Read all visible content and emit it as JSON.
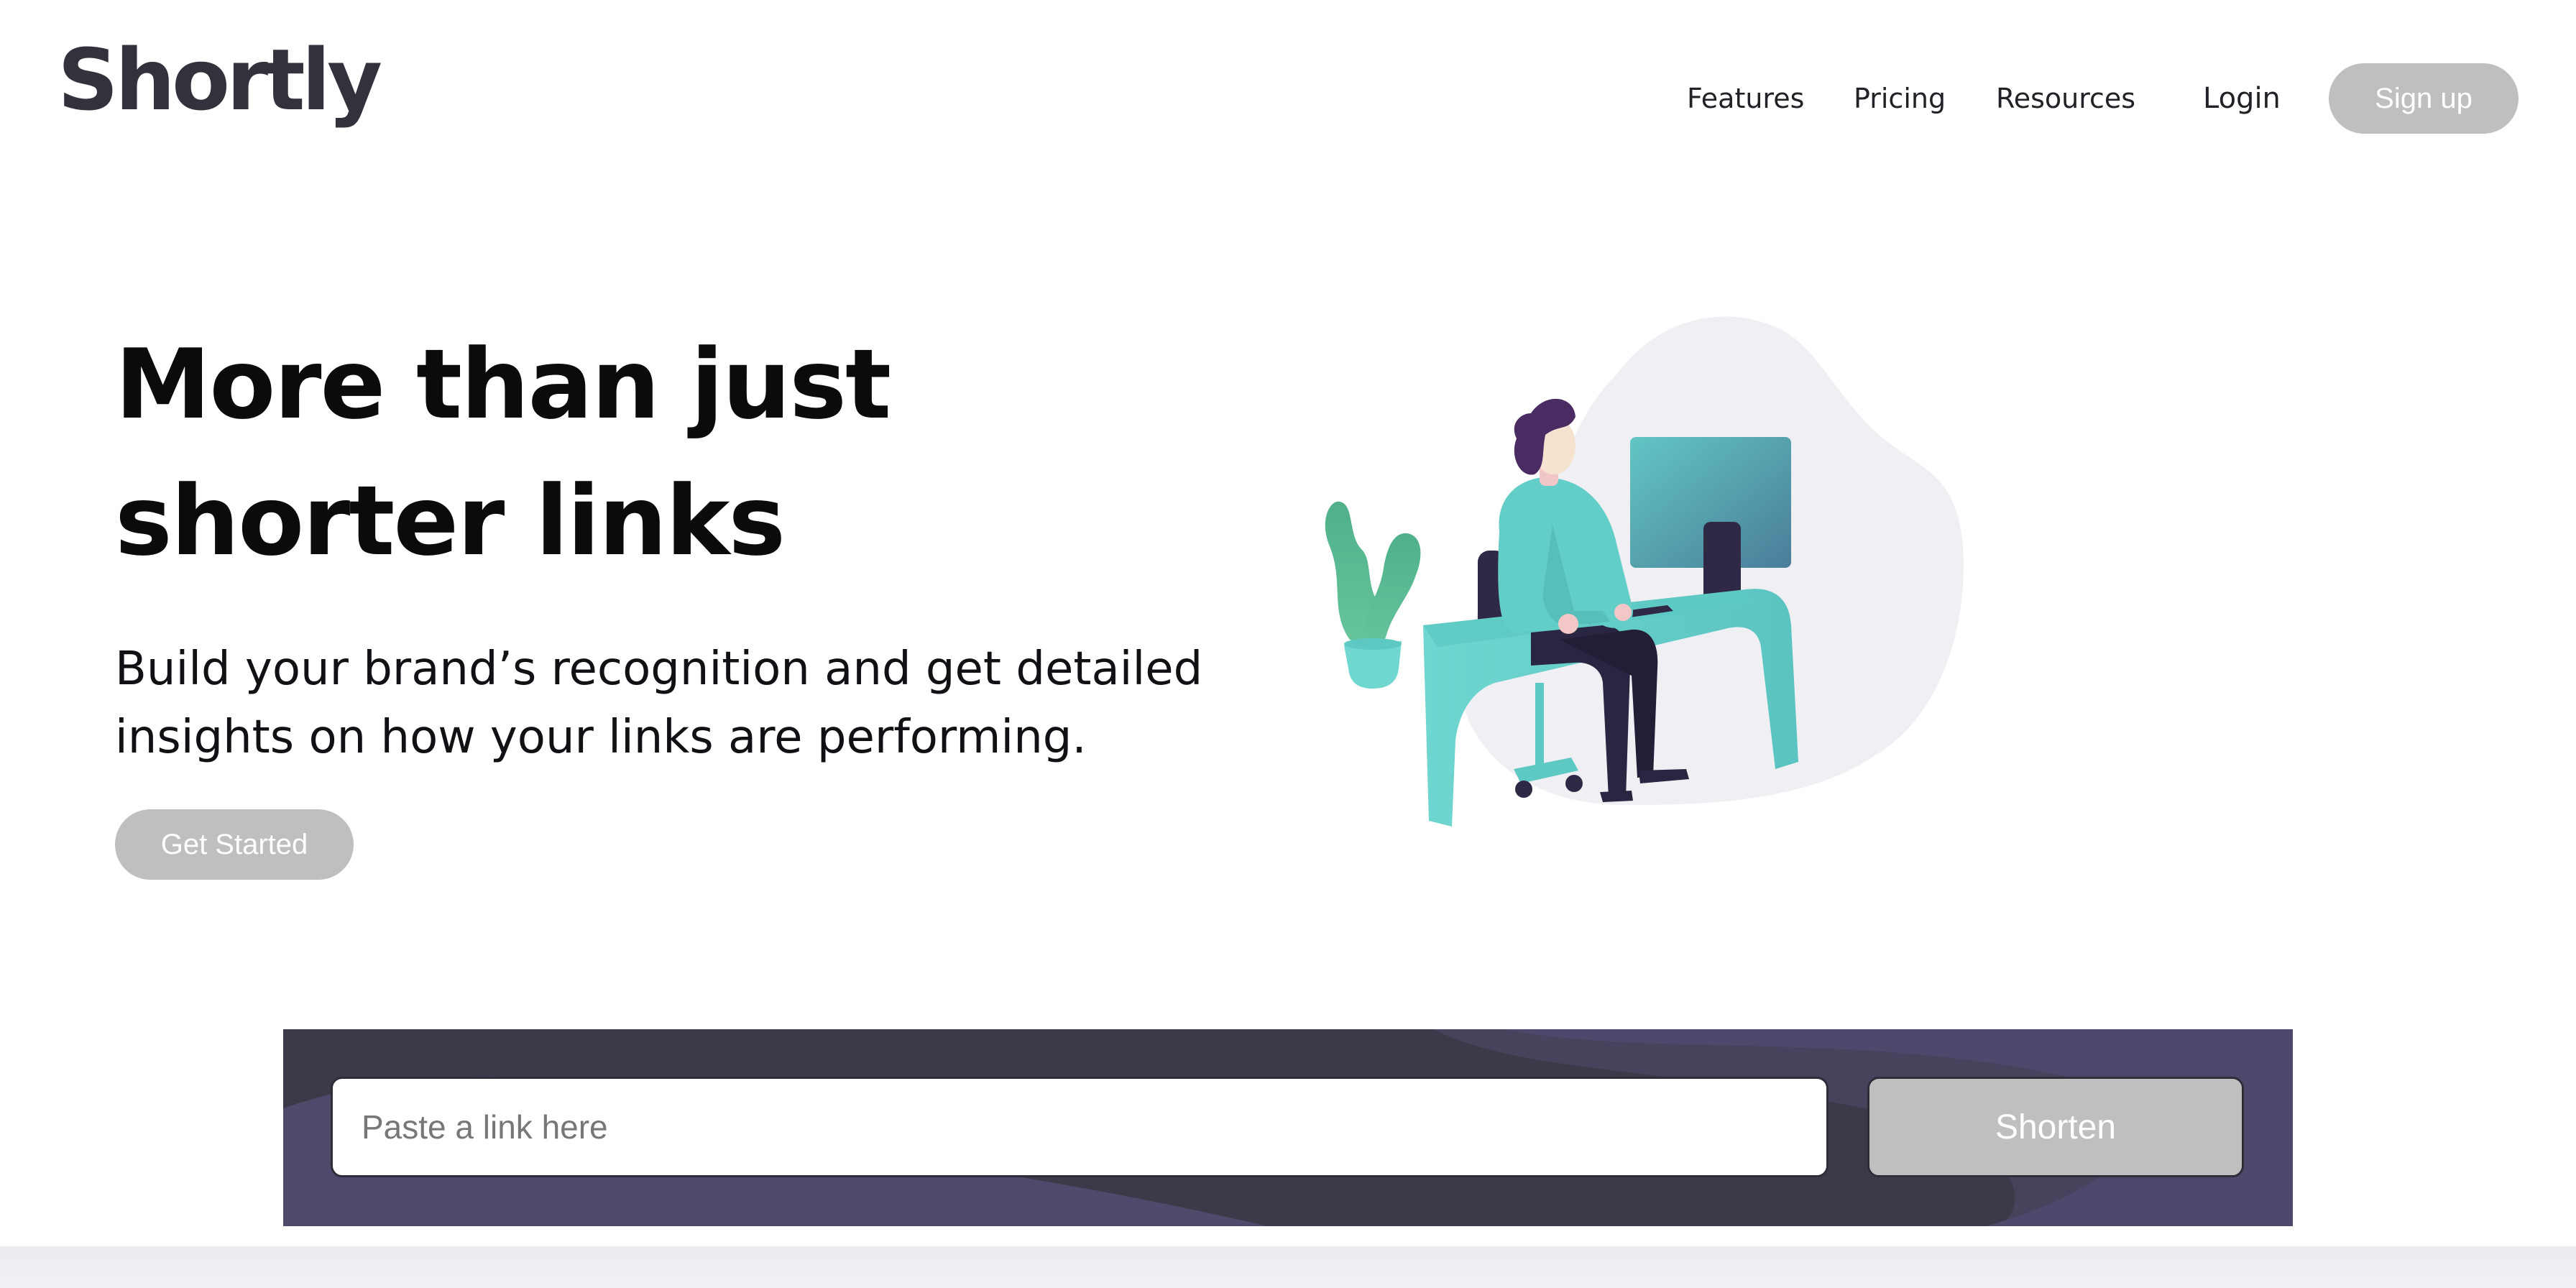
{
  "header": {
    "logo": "Shortly",
    "nav": {
      "features": "Features",
      "pricing": "Pricing",
      "resources": "Resources"
    },
    "login": "Login",
    "signup": "Sign up"
  },
  "hero": {
    "title": "More than just shorter links",
    "subtitle": "Build your brand’s recognition and get detailed insights on how your links are performing.",
    "cta": "Get Started",
    "illustration": "person-working-at-desk-illustration"
  },
  "shorten": {
    "placeholder": "Paste a link here",
    "button": "Shorten"
  },
  "colors": {
    "logo": "#34313d",
    "button_gray": "#bfbfbf",
    "band_dark": "#3b3a48",
    "band_purple": "#4e4a6c",
    "blob": "#efeff4",
    "teal": "#5fcfcb"
  }
}
